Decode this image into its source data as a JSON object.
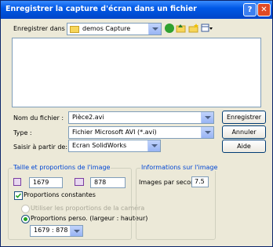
{
  "window": {
    "title": "Enregistrer la capture d'écran dans un fichier",
    "help_icon": "?",
    "close_icon": "✕"
  },
  "location": {
    "label": "Enregistrer dans :",
    "value": "demos Capture"
  },
  "fields": {
    "filename_label": "Nom du fichier :",
    "filename_value": "Pièce2.avi",
    "type_label": "Type :",
    "type_value": "Fichier Microsoft AVI (*.avi)",
    "capture_label": "Saisir à partir de:",
    "capture_value": "Ecran SolidWorks"
  },
  "buttons": {
    "save": "Enregistrer",
    "cancel": "Annuler",
    "help": "Aide"
  },
  "size_group": {
    "title": "Taille et proportions de l'image",
    "width": "1679",
    "height": "878",
    "constant_label": "Proportions constantes",
    "camera_label": "Utiliser les proportions de la caméra",
    "custom_label": "Proportions perso. (largeur : hauteur)",
    "ratio_value": "1679 : 878"
  },
  "info_group": {
    "title": "Informations sur l'image",
    "fps_label": "Images par seconde",
    "fps_value": "7.5"
  }
}
